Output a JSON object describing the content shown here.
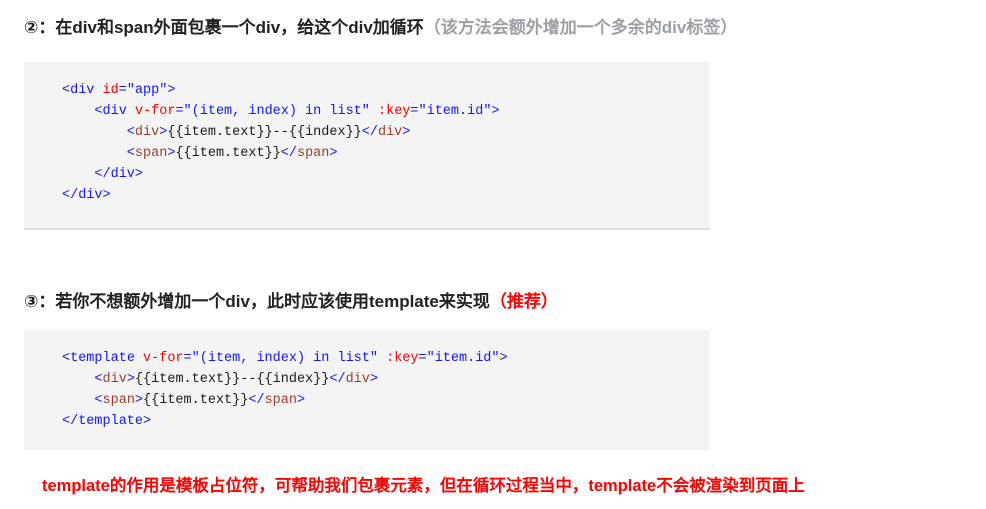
{
  "sections": [
    {
      "marker": "②：",
      "title": "在div和span外面包裹一个div，给这个div加循环",
      "note": "（该方法会额外增加一个多余的div标签）",
      "note_color": "#9aa0a6"
    },
    {
      "marker": "③：",
      "title": "若你不想额外增加一个div，此时应该使用template来实现",
      "note": "（推荐）",
      "note_color": "#ff0000"
    }
  ],
  "code_blocks": [
    {
      "name": "wrapper-div-example",
      "lines": [
        [
          {
            "t": "<",
            "c": "br"
          },
          {
            "t": "div",
            "c": "tagb"
          },
          {
            "t": " ",
            "c": "txt"
          },
          {
            "t": "id",
            "c": "attr"
          },
          {
            "t": "=\"app\"",
            "c": "str"
          },
          {
            "t": ">",
            "c": "br"
          }
        ],
        [
          {
            "t": "    <",
            "c": "br"
          },
          {
            "t": "div",
            "c": "tagb"
          },
          {
            "t": " ",
            "c": "txt"
          },
          {
            "t": "v-for",
            "c": "attr"
          },
          {
            "t": "=\"(item, index) in list\"",
            "c": "str"
          },
          {
            "t": " ",
            "c": "txt"
          },
          {
            "t": ":key",
            "c": "attr"
          },
          {
            "t": "=\"item.id\"",
            "c": "str"
          },
          {
            "t": ">",
            "c": "br"
          }
        ],
        [
          {
            "t": "        <",
            "c": "br"
          },
          {
            "t": "div",
            "c": "tag"
          },
          {
            "t": ">",
            "c": "br"
          },
          {
            "t": "{{item.text}}--{{index}}",
            "c": "txt"
          },
          {
            "t": "</",
            "c": "br"
          },
          {
            "t": "div",
            "c": "tag"
          },
          {
            "t": ">",
            "c": "br"
          }
        ],
        [
          {
            "t": "        <",
            "c": "br"
          },
          {
            "t": "span",
            "c": "tag"
          },
          {
            "t": ">",
            "c": "br"
          },
          {
            "t": "{{item.text}}",
            "c": "txt"
          },
          {
            "t": "</",
            "c": "br"
          },
          {
            "t": "span",
            "c": "tag"
          },
          {
            "t": ">",
            "c": "br"
          }
        ],
        [
          {
            "t": "    </",
            "c": "br"
          },
          {
            "t": "div",
            "c": "tagb"
          },
          {
            "t": ">",
            "c": "br"
          }
        ],
        [
          {
            "t": "</",
            "c": "br"
          },
          {
            "t": "div",
            "c": "tagb"
          },
          {
            "t": ">",
            "c": "br"
          }
        ]
      ]
    },
    {
      "name": "template-example",
      "lines": [
        [
          {
            "t": "<",
            "c": "br"
          },
          {
            "t": "template",
            "c": "tagb"
          },
          {
            "t": " ",
            "c": "txt"
          },
          {
            "t": "v-for",
            "c": "attr"
          },
          {
            "t": "=\"(item, index) in list\"",
            "c": "str"
          },
          {
            "t": " ",
            "c": "txt"
          },
          {
            "t": ":key",
            "c": "attr"
          },
          {
            "t": "=\"item.id\"",
            "c": "str"
          },
          {
            "t": ">",
            "c": "br"
          }
        ],
        [
          {
            "t": "    <",
            "c": "br"
          },
          {
            "t": "div",
            "c": "tag"
          },
          {
            "t": ">",
            "c": "br"
          },
          {
            "t": "{{item.text}}--{{index}}",
            "c": "txt"
          },
          {
            "t": "</",
            "c": "br"
          },
          {
            "t": "div",
            "c": "tag"
          },
          {
            "t": ">",
            "c": "br"
          }
        ],
        [
          {
            "t": "    <",
            "c": "br"
          },
          {
            "t": "span",
            "c": "tag"
          },
          {
            "t": ">",
            "c": "br"
          },
          {
            "t": "{{item.text}}",
            "c": "txt"
          },
          {
            "t": "</",
            "c": "br"
          },
          {
            "t": "span",
            "c": "tag"
          },
          {
            "t": ">",
            "c": "br"
          }
        ],
        [
          {
            "t": "</",
            "c": "br"
          },
          {
            "t": "template",
            "c": "tagb"
          },
          {
            "t": ">",
            "c": "br"
          }
        ]
      ]
    }
  ],
  "footer_note": {
    "text": "template的作用是模板占位符，可帮助我们包裹元素，但在循环过程当中，template不会被渲染到页面上",
    "color": "#ff0000"
  },
  "colors": {
    "code_background": "#f4f4f4",
    "bracket": "#1414ff",
    "tag_name": "#9c3b2e",
    "attribute": "#ff0000",
    "string": "#1414ff",
    "text": "#1c1c1c",
    "heading": "#222222",
    "note_gray": "#9aa0a6",
    "accent_red": "#ff0000"
  }
}
